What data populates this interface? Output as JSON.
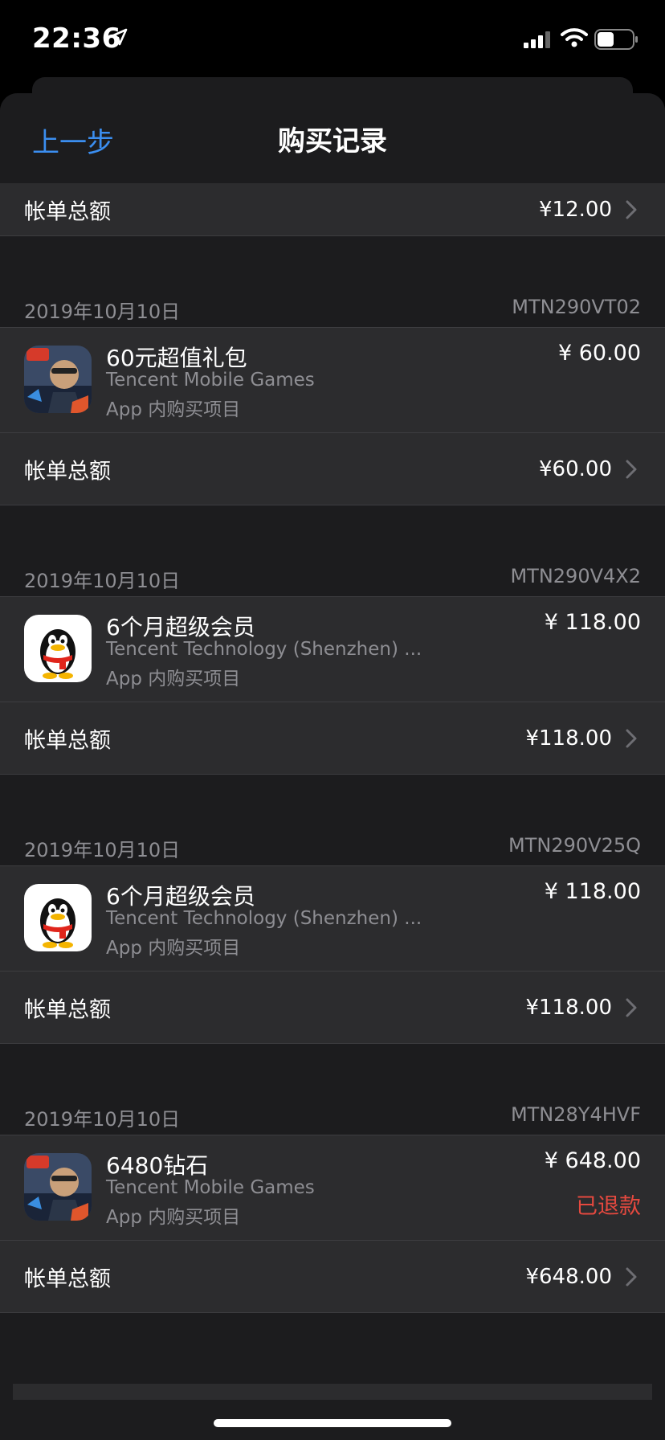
{
  "status_bar": {
    "time": "22:36"
  },
  "nav": {
    "back_label": "上一步",
    "title": "购买记录"
  },
  "first_total": {
    "label": "帐单总额",
    "amount": "¥12.00"
  },
  "sections": [
    {
      "date": "2019年10月10日",
      "order_id": "MTN290VT02",
      "item": {
        "icon": "game-icon",
        "title": "60元超值礼包",
        "developer": "Tencent Mobile Games",
        "type": "App 内购买项目",
        "price": "¥ 60.00",
        "status": ""
      },
      "total": {
        "label": "帐单总额",
        "amount": "¥60.00"
      }
    },
    {
      "date": "2019年10月10日",
      "order_id": "MTN290V4X2",
      "item": {
        "icon": "qq-penguin-icon",
        "title": "6个月超级会员",
        "developer": "Tencent Technology (Shenzhen) ...",
        "type": "App 内购买项目",
        "price": "¥ 118.00",
        "status": ""
      },
      "total": {
        "label": "帐单总额",
        "amount": "¥118.00"
      }
    },
    {
      "date": "2019年10月10日",
      "order_id": "MTN290V25Q",
      "item": {
        "icon": "qq-penguin-icon",
        "title": "6个月超级会员",
        "developer": "Tencent Technology (Shenzhen) ...",
        "type": "App 内购买项目",
        "price": "¥ 118.00",
        "status": ""
      },
      "total": {
        "label": "帐单总额",
        "amount": "¥118.00"
      }
    },
    {
      "date": "2019年10月10日",
      "order_id": "MTN28Y4HVF",
      "item": {
        "icon": "game-icon",
        "title": "6480钻石",
        "developer": "Tencent Mobile Games",
        "type": "App 内购买项目",
        "price": "¥ 648.00",
        "status": "已退款"
      },
      "total": {
        "label": "帐单总额",
        "amount": "¥648.00"
      }
    }
  ],
  "colors": {
    "accent": "#3b8ef0",
    "refund": "#e5493f",
    "background": "#1c1c1e",
    "row": "#2c2c2e"
  }
}
